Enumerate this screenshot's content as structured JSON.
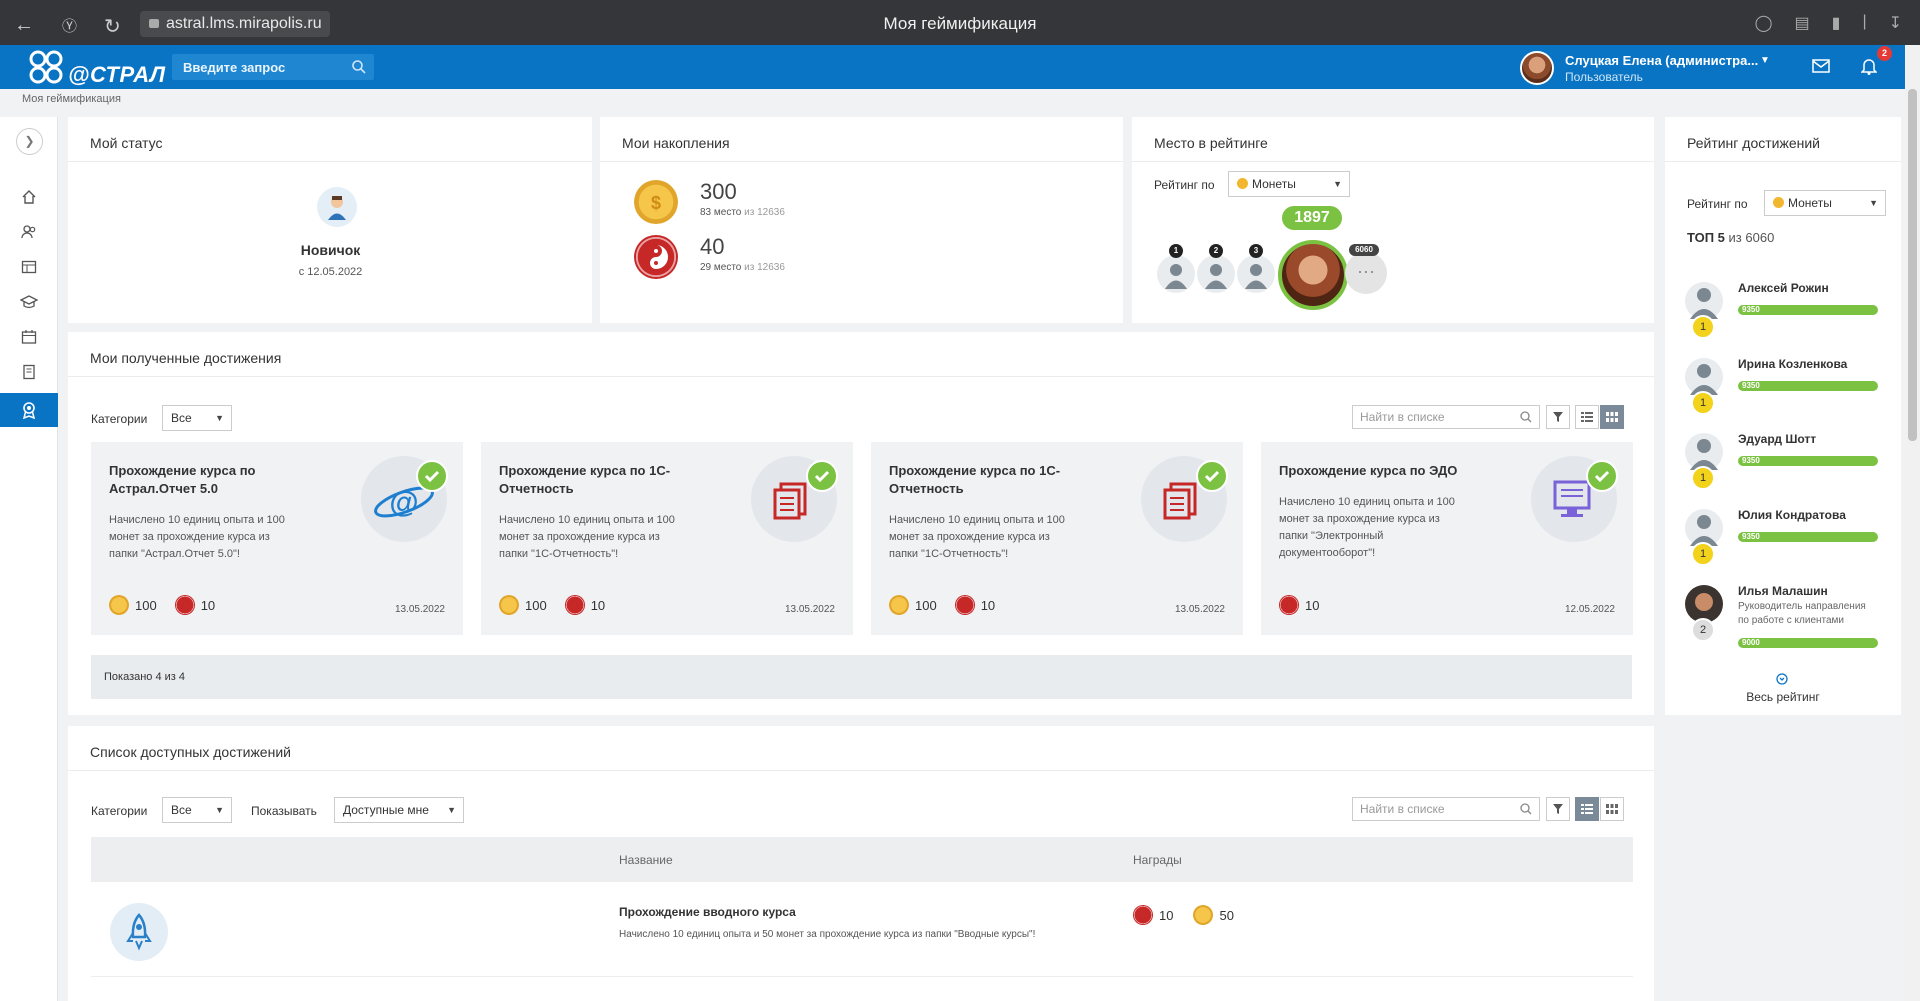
{
  "browser": {
    "url": "astral.lms.mirapolis.ru",
    "title": "Моя геймификация"
  },
  "appbar": {
    "logo_text": "@СТРАЛ",
    "search_placeholder": "Введите запрос",
    "user_name": "Слуцкая Елена (администра...",
    "user_role": "Пользователь",
    "notifications_count": "2"
  },
  "breadcrumb": "Моя геймификация",
  "my_status": {
    "title": "Мой статус",
    "level": "Новичок",
    "since": "с 12.05.2022"
  },
  "savings": {
    "title": "Мои накопления",
    "items": [
      {
        "value": "300",
        "place": "83 место",
        "of": "из 12636",
        "icon": "coin-icon"
      },
      {
        "value": "40",
        "place": "29 место",
        "of": "из 12636",
        "icon": "yin-yang-icon"
      }
    ]
  },
  "rating_place": {
    "title": "Место в рейтинге",
    "label": "Рейтинг по",
    "selected": "Монеты",
    "top_ranks": [
      "1",
      "2",
      "3"
    ],
    "my_score": "1897",
    "total": "6060",
    "more": "···"
  },
  "achievements": {
    "title": "Мои полученные достижения",
    "categories_label": "Категории",
    "categories_value": "Все",
    "search_placeholder": "Найти в списке",
    "cards": [
      {
        "title": "Прохождение курса по Астрал.Отчет 5.0",
        "desc": "Начислено 10 единиц опыта и 100 монет за прохождение курса из папки \"Астрал.Отчет 5.0\"!",
        "coins": "100",
        "xp": "10",
        "date": "13.05.2022",
        "icon": "planet-at-icon"
      },
      {
        "title": "Прохождение курса по 1С-Отчетность",
        "desc": "Начислено 10 единиц опыта и 100 монет за прохождение курса из папки \"1С-Отчетность\"!",
        "coins": "100",
        "xp": "10",
        "date": "13.05.2022",
        "icon": "documents-icon"
      },
      {
        "title": "Прохождение курса по 1С-Отчетность",
        "desc": "Начислено 10 единиц опыта и 100 монет за прохождение курса из папки \"1С-Отчетность\"!",
        "coins": "100",
        "xp": "10",
        "date": "13.05.2022",
        "icon": "documents-icon"
      },
      {
        "title": "Прохождение курса по ЭДО",
        "desc": "Начислено 10 единиц опыта и 100 монет за прохождение курса из папки \"Электронный документооборот\"!",
        "coins": "",
        "xp": "10",
        "date": "12.05.2022",
        "icon": "computer-icon"
      }
    ],
    "shown": "Показано 4 из 4"
  },
  "available": {
    "title": "Список доступных достижений",
    "categories_label": "Категории",
    "categories_value": "Все",
    "show_label": "Показывать",
    "show_value": "Доступные мне",
    "search_placeholder": "Найти в списке",
    "columns": [
      "Название",
      "Награды"
    ],
    "rows": [
      {
        "title": "Прохождение вводного курса",
        "desc": "Начислено 10 единиц опыта и 50 монет за прохождение курса из папки \"Вводные курсы\"!",
        "xp": "10",
        "coins": "50",
        "icon": "rocket-icon"
      }
    ]
  },
  "achievements_rating": {
    "title": "Рейтинг достижений",
    "label": "Рейтинг по",
    "selected": "Монеты",
    "top_label": "ТОП 5",
    "top_of": "из 6060",
    "items": [
      {
        "name": "Алексей Рожин",
        "sub": "",
        "score": "9350",
        "pos": "1"
      },
      {
        "name": "Ирина Козленкова",
        "sub": "",
        "score": "9350",
        "pos": "1"
      },
      {
        "name": "Эдуард Шотт",
        "sub": "",
        "score": "9350",
        "pos": "1"
      },
      {
        "name": "Юлия Кондратова",
        "sub": "",
        "score": "9350",
        "pos": "1"
      },
      {
        "name": "Илья Малашин",
        "sub": "Руководитель направления по работе с клиентами",
        "score": "9000",
        "pos": "2"
      }
    ],
    "all_link": "Весь рейтинг"
  },
  "colors": {
    "brand": "#0a74c4",
    "green": "#7cc242",
    "gold": "#f3b62f",
    "red": "#c62828"
  }
}
